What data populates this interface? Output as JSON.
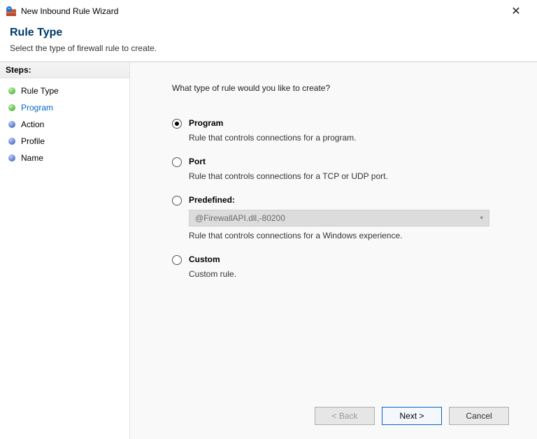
{
  "window": {
    "title": "New Inbound Rule Wizard"
  },
  "header": {
    "title": "Rule Type",
    "subtitle": "Select the type of firewall rule to create."
  },
  "steps": {
    "header": "Steps:",
    "items": [
      {
        "label": "Rule Type",
        "state": "current"
      },
      {
        "label": "Program",
        "state": "next"
      },
      {
        "label": "Action",
        "state": "future"
      },
      {
        "label": "Profile",
        "state": "future"
      },
      {
        "label": "Name",
        "state": "future"
      }
    ]
  },
  "content": {
    "question": "What type of rule would you like to create?",
    "options": {
      "program": {
        "label": "Program",
        "desc": "Rule that controls connections for a program.",
        "selected": true
      },
      "port": {
        "label": "Port",
        "desc": "Rule that controls connections for a TCP or UDP port.",
        "selected": false
      },
      "predefined": {
        "label": "Predefined:",
        "select_value": "@FirewallAPI.dll,-80200",
        "desc": "Rule that controls connections for a Windows experience.",
        "selected": false
      },
      "custom": {
        "label": "Custom",
        "desc": "Custom rule.",
        "selected": false
      }
    }
  },
  "buttons": {
    "back": "< Back",
    "next": "Next >",
    "cancel": "Cancel"
  }
}
